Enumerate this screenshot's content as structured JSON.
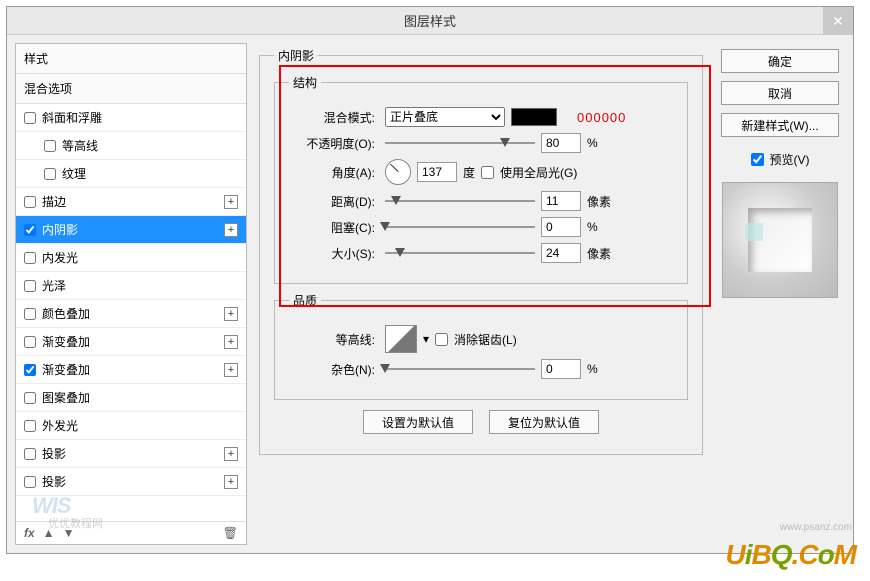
{
  "dialog": {
    "title": "图层样式"
  },
  "left": {
    "styles_header": "样式",
    "blend_options": "混合选项",
    "items": [
      {
        "label": "斜面和浮雕",
        "checked": false,
        "indent": false,
        "plus": false
      },
      {
        "label": "等高线",
        "checked": false,
        "indent": true,
        "plus": false
      },
      {
        "label": "纹理",
        "checked": false,
        "indent": true,
        "plus": false
      },
      {
        "label": "描边",
        "checked": false,
        "indent": false,
        "plus": true
      },
      {
        "label": "内阴影",
        "checked": true,
        "indent": false,
        "plus": true,
        "selected": true
      },
      {
        "label": "内发光",
        "checked": false,
        "indent": false,
        "plus": false
      },
      {
        "label": "光泽",
        "checked": false,
        "indent": false,
        "plus": false
      },
      {
        "label": "颜色叠加",
        "checked": false,
        "indent": false,
        "plus": true
      },
      {
        "label": "渐变叠加",
        "checked": false,
        "indent": false,
        "plus": true
      },
      {
        "label": "渐变叠加",
        "checked": true,
        "indent": false,
        "plus": true
      },
      {
        "label": "图案叠加",
        "checked": false,
        "indent": false,
        "plus": false
      },
      {
        "label": "外发光",
        "checked": false,
        "indent": false,
        "plus": false
      },
      {
        "label": "投影",
        "checked": false,
        "indent": false,
        "plus": true
      },
      {
        "label": "投影",
        "checked": false,
        "indent": false,
        "plus": true
      }
    ],
    "footer": {
      "fx": "fx",
      "trash_title": "删除"
    }
  },
  "center": {
    "section_title": "内阴影",
    "structure_title": "结构",
    "blend_mode_label": "混合模式:",
    "blend_mode_value": "正片叠底",
    "hex_annotation": "000000",
    "opacity_label": "不透明度(O):",
    "opacity_value": "80",
    "opacity_unit": "%",
    "angle_label": "角度(A):",
    "angle_value": "137",
    "angle_unit": "度",
    "global_light_label": "使用全局光(G)",
    "distance_label": "距离(D):",
    "distance_value": "11",
    "distance_unit": "像素",
    "choke_label": "阻塞(C):",
    "choke_value": "0",
    "choke_unit": "%",
    "size_label": "大小(S):",
    "size_value": "24",
    "size_unit": "像素",
    "quality_title": "品质",
    "contour_label": "等高线:",
    "antialias_label": "消除锯齿(L)",
    "noise_label": "杂色(N):",
    "noise_value": "0",
    "noise_unit": "%",
    "btn_default": "设置为默认值",
    "btn_reset": "复位为默认值"
  },
  "right": {
    "ok": "确定",
    "cancel": "取消",
    "new_style": "新建样式(W)...",
    "preview_label": "预览(V)"
  },
  "watermarks": {
    "w1": "WIS",
    "w1b": "优优教程网",
    "w2_a": "U",
    "w2_b": "i",
    "w2_c": "B",
    "w2_d": "Q",
    "w2_e": ".",
    "w2_f": "C",
    "w2_g": "o",
    "w2_h": "M",
    "w2b": "www.psanz.com"
  }
}
